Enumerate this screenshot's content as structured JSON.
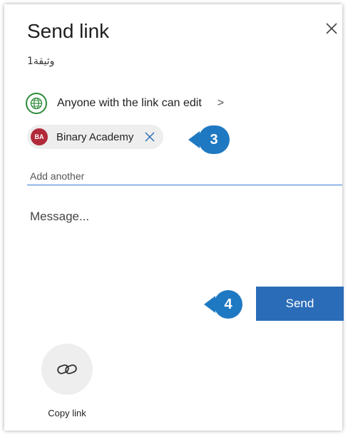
{
  "dialog": {
    "title": "Send link",
    "document_name": "وثيقة1",
    "close_icon": "close-icon"
  },
  "permission": {
    "icon": "globe-icon",
    "label": "Anyone with the link can edit",
    "chevron": ">"
  },
  "recipients": [
    {
      "initials": "BA",
      "name": "Binary Academy",
      "avatar_color": "#b22a3a"
    }
  ],
  "add_recipient": {
    "placeholder": "Add another"
  },
  "message": {
    "placeholder": "Message..."
  },
  "send_button": {
    "label": "Send",
    "color": "#2b6cb8"
  },
  "copy_link": {
    "icon": "link-icon",
    "label": "Copy link"
  },
  "callouts": [
    {
      "number": "3",
      "color": "#1f79c2"
    },
    {
      "number": "4",
      "color": "#1f79c2"
    }
  ]
}
